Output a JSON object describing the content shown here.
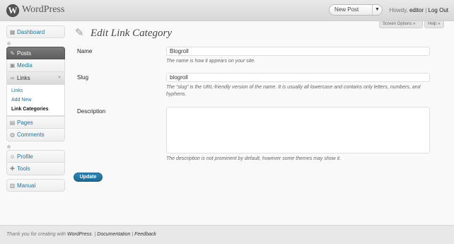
{
  "header": {
    "site_title": "WordPress",
    "logo_letter": "W",
    "new_post_label": "New Post",
    "howdy": "Howdy,",
    "username": "editor",
    "separator": "|",
    "logout": "Log Out",
    "screen_options": "Screen Options »",
    "help": "Help »"
  },
  "sidebar": {
    "dashboard": "Dashboard",
    "posts": "Posts",
    "media": "Media",
    "links": "Links",
    "links_sub": [
      "Links",
      "Add New",
      "Link Categories"
    ],
    "pages": "Pages",
    "comments": "Comments",
    "profile": "Profile",
    "tools": "Tools",
    "manual": "Manual"
  },
  "main": {
    "title": "Edit Link Category",
    "name_label": "Name",
    "name_value": "Blogroll",
    "name_desc": "The name is how it appears on your site.",
    "slug_label": "Slug",
    "slug_value": "blogroll",
    "slug_desc": "The “slug” is the URL-friendly version of the name. It is usually all lowercase and contains only letters, numbers, and hyphens.",
    "description_label": "Description",
    "description_value": "",
    "description_desc": "The description is not prominent by default, however some themes may show it.",
    "update_button": "Update"
  },
  "footer": {
    "thanks_prefix": "Thank you for creating with ",
    "wordpress_link": "WordPress",
    "period": ".",
    "sep1": " | ",
    "documentation": "Documentation",
    "sep2": " | ",
    "feedback": "Feedback"
  },
  "colors": {
    "link": "#21759b",
    "button": "#21759b",
    "header_bg": "#e4e4e4"
  }
}
